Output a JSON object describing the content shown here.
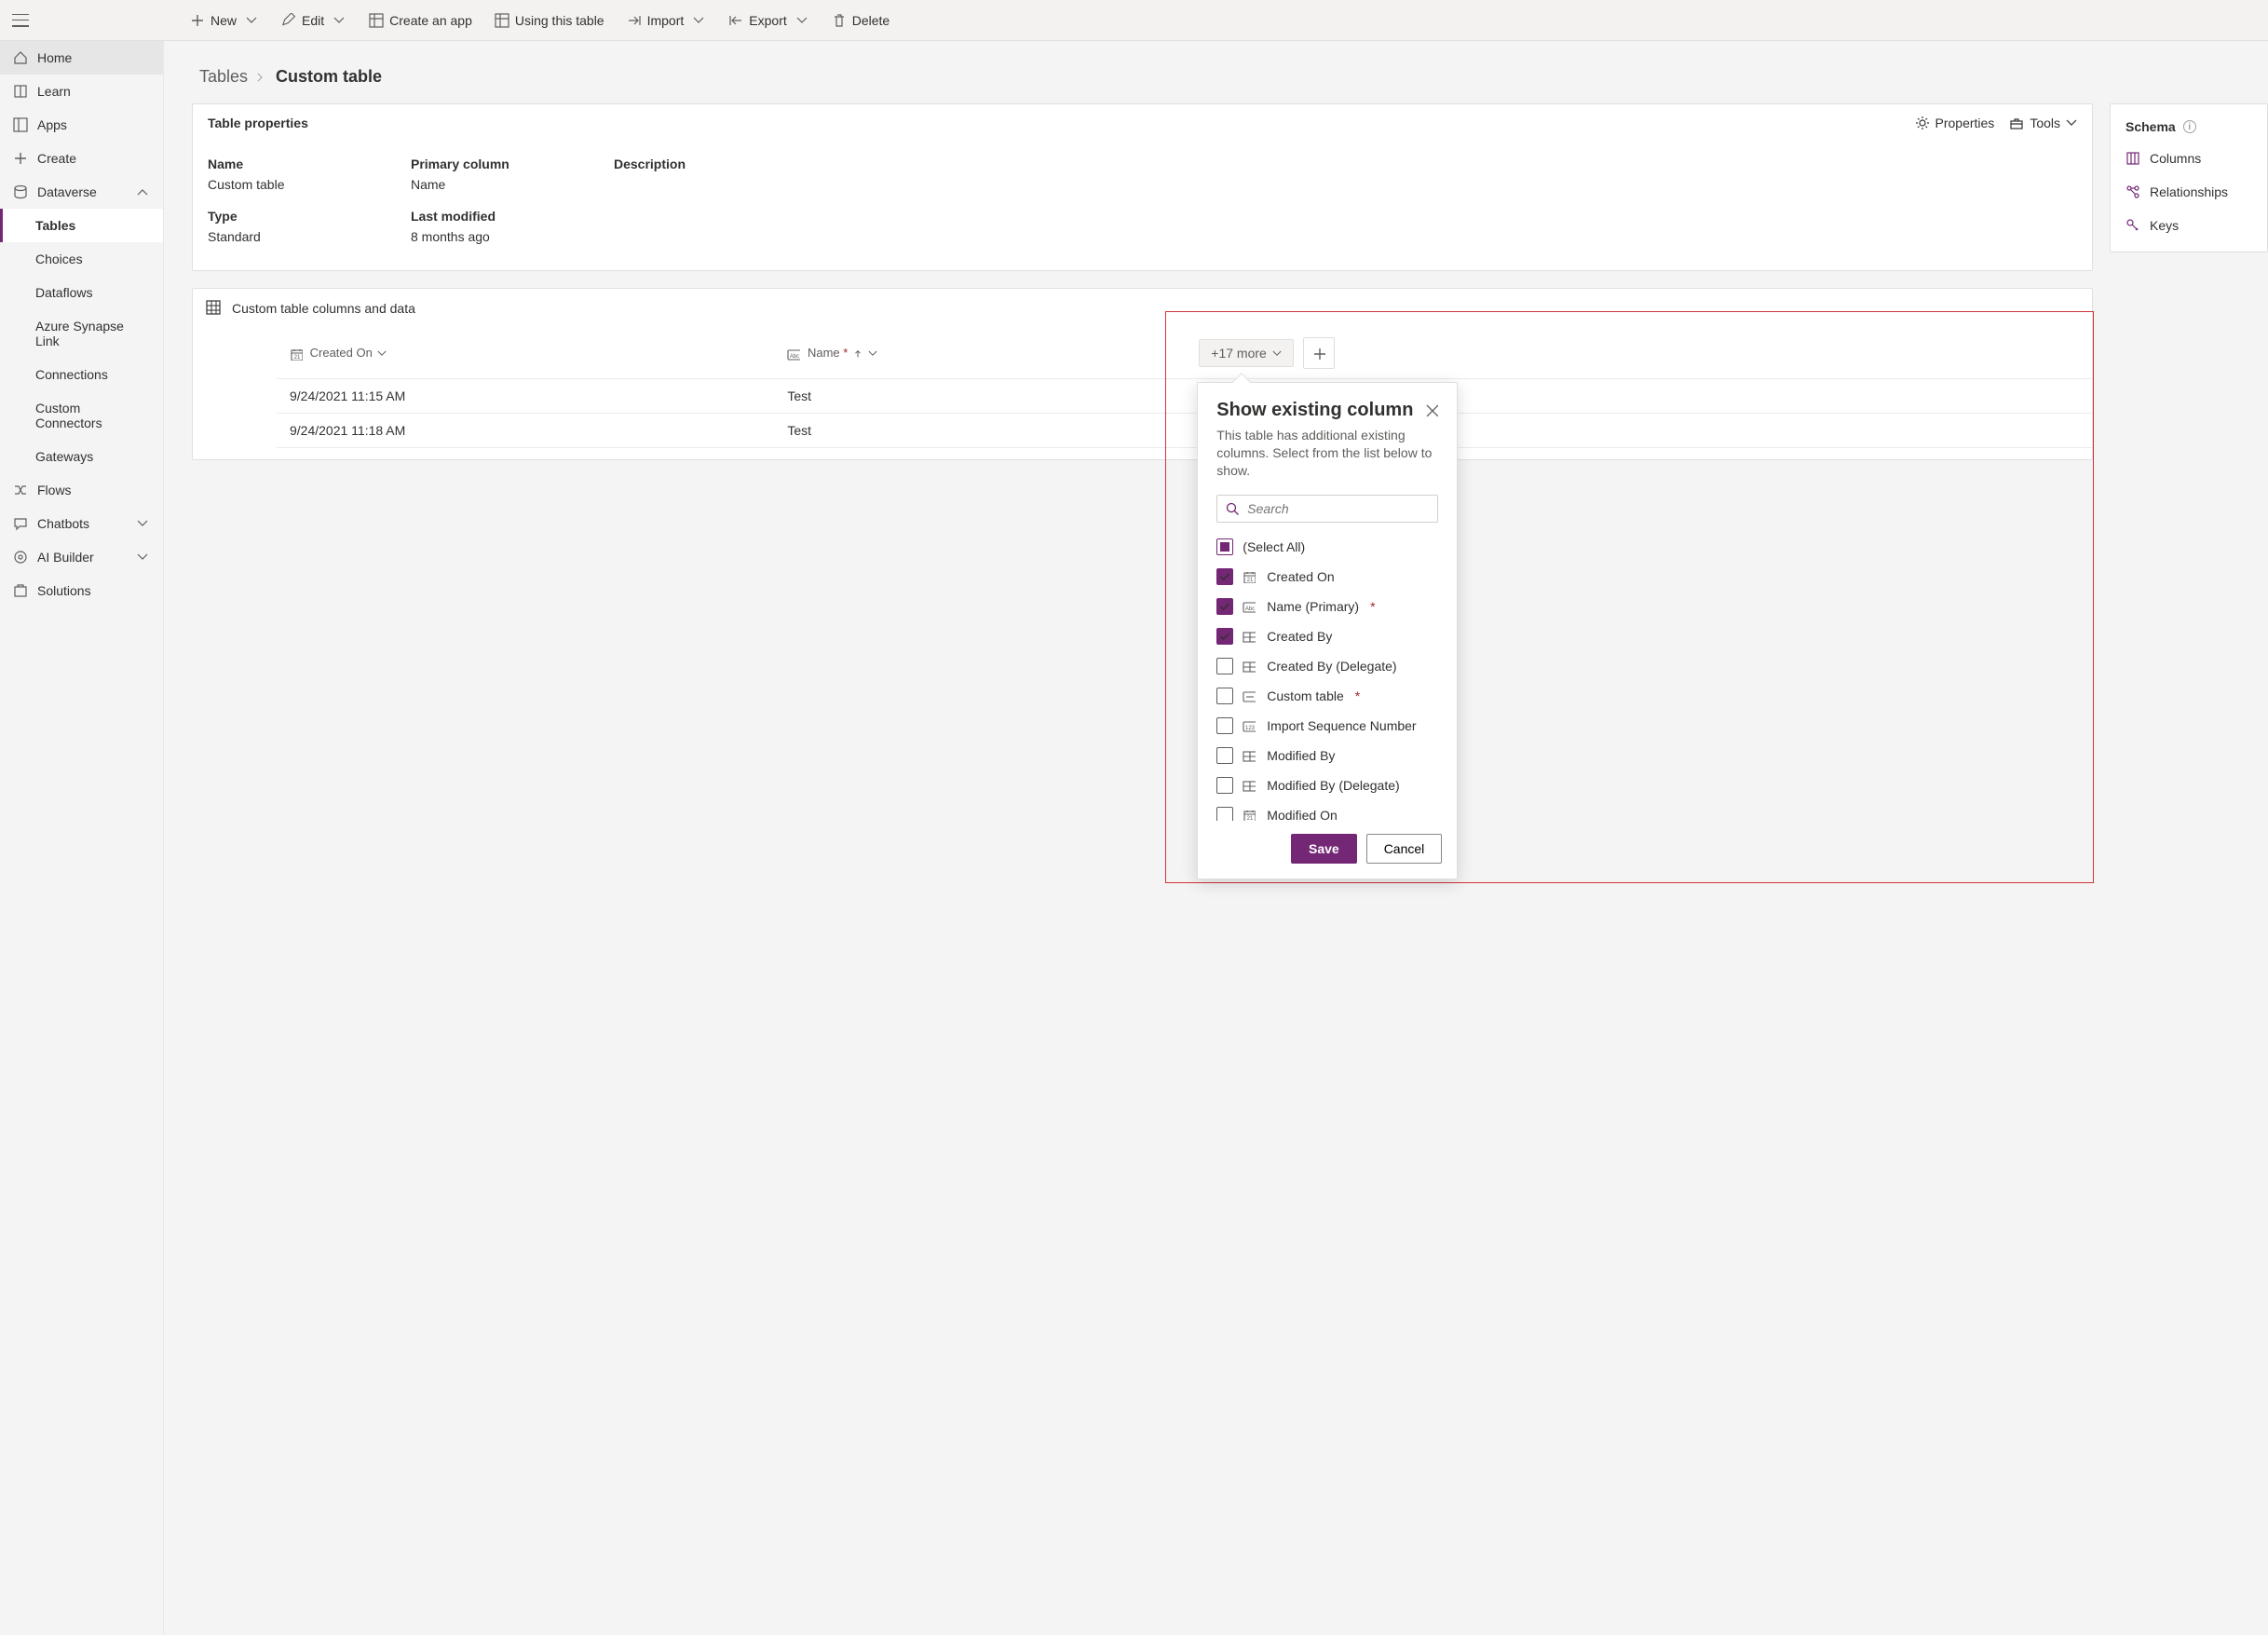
{
  "commands": {
    "new": "New",
    "edit": "Edit",
    "create_app": "Create an app",
    "using_table": "Using this table",
    "import": "Import",
    "export": "Export",
    "delete": "Delete"
  },
  "sidebar": {
    "home": "Home",
    "learn": "Learn",
    "apps": "Apps",
    "create": "Create",
    "dataverse": "Dataverse",
    "dv_items": [
      "Tables",
      "Choices",
      "Dataflows",
      "Azure Synapse Link",
      "Connections",
      "Custom Connectors",
      "Gateways"
    ],
    "flows": "Flows",
    "chatbots": "Chatbots",
    "ai_builder": "AI Builder",
    "solutions": "Solutions"
  },
  "breadcrumb": {
    "root": "Tables",
    "leaf": "Custom table"
  },
  "prop_card": {
    "title": "Table properties",
    "properties_btn": "Properties",
    "tools_btn": "Tools",
    "labels": {
      "name": "Name",
      "primary": "Primary column",
      "description": "Description",
      "type": "Type",
      "last_mod": "Last modified"
    },
    "values": {
      "name": "Custom table",
      "primary": "Name",
      "type": "Standard",
      "last_mod": "8 months ago"
    }
  },
  "schema": {
    "title": "Schema",
    "items": [
      "Columns",
      "Relationships",
      "Keys"
    ]
  },
  "data_card": {
    "title": "Custom table columns and data",
    "columns": {
      "created_on": "Created On",
      "name": "Name"
    },
    "more_label": "+17 more",
    "rows": [
      {
        "created_on": "9/24/2021 11:15 AM",
        "name": "Test"
      },
      {
        "created_on": "9/24/2021 11:18 AM",
        "name": "Test"
      }
    ]
  },
  "popover": {
    "title": "Show existing column",
    "subtitle": "This table has additional existing columns. Select from the list below to show.",
    "search_placeholder": "Search",
    "select_all": "(Select All)",
    "options": [
      {
        "label": "Created On",
        "kind": "date",
        "selected": true
      },
      {
        "label": "Name (Primary)",
        "kind": "text",
        "selected": true,
        "required": true
      },
      {
        "label": "Created By",
        "kind": "lookup",
        "selected": true
      },
      {
        "label": "Created By (Delegate)",
        "kind": "lookup",
        "selected": false
      },
      {
        "label": "Custom table",
        "kind": "key",
        "selected": false,
        "required": true
      },
      {
        "label": "Import Sequence Number",
        "kind": "number",
        "selected": false
      },
      {
        "label": "Modified By",
        "kind": "lookup",
        "selected": false
      },
      {
        "label": "Modified By (Delegate)",
        "kind": "lookup",
        "selected": false
      },
      {
        "label": "Modified On",
        "kind": "date",
        "selected": false
      }
    ],
    "save": "Save",
    "cancel": "Cancel"
  }
}
